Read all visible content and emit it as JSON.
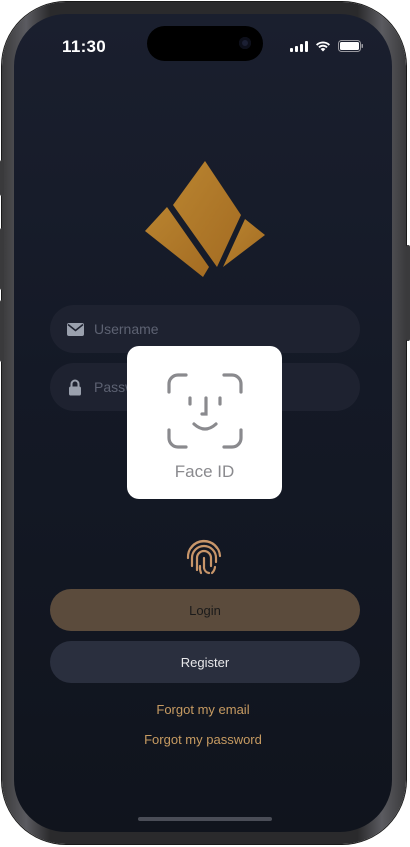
{
  "status_bar": {
    "time": "11:30",
    "icons": [
      "cellular-signal-icon",
      "wifi-icon",
      "battery-icon"
    ]
  },
  "logo": {
    "icon": "diamond-logo",
    "color": "#b07a2a"
  },
  "form": {
    "username_placeholder": "Username",
    "password_placeholder": "Password",
    "username_icon": "mail-icon",
    "password_icon": "lock-icon"
  },
  "faceid_modal": {
    "label": "Face ID",
    "icon": "face-id-icon"
  },
  "fingerprint": {
    "icon": "fingerprint-icon",
    "color": "#c8966a"
  },
  "buttons": {
    "login_label": "Login",
    "register_label": "Register"
  },
  "links": {
    "forgot_email": "Forgot my email",
    "forgot_password": "Forgot my password"
  },
  "colors": {
    "background": "#141926",
    "accent": "#c79b62",
    "login_button": "#5b4b3c",
    "register_button": "#2a2f3e"
  }
}
